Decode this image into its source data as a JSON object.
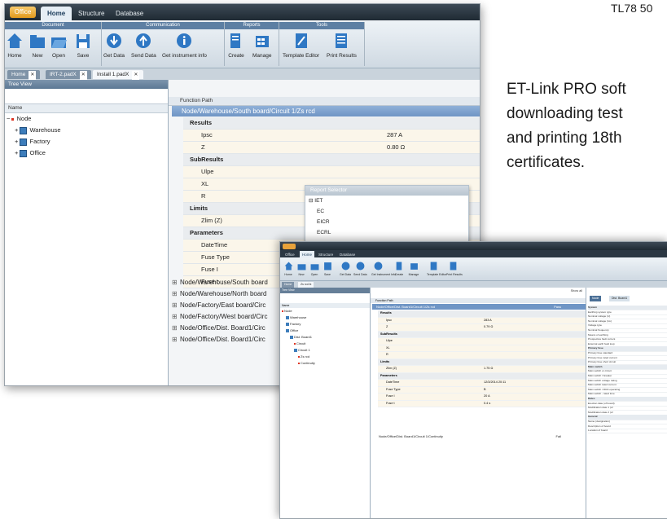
{
  "model_code": "TL78 50",
  "description_lines": [
    "ET-Link PRO soft",
    "downloading test",
    "and printing 18th",
    "certificates."
  ],
  "screenshot_back": {
    "app_button": "Office",
    "menu_tabs": [
      "Home",
      "Structure",
      "Database"
    ],
    "ribbon_groups": [
      "Document",
      "Communication",
      "Reports",
      "Tools"
    ],
    "ribbon_buttons": [
      "Home",
      "New",
      "Open",
      "Save",
      "Get Data",
      "Send Data",
      "Get instrument info",
      "Create",
      "Manage",
      "Template Editor",
      "Print Results"
    ],
    "doc_tabs": [
      "Home",
      "IRT-2.padX",
      "Install 1.padX"
    ],
    "tree_view_title": "Tree View",
    "tree_column": "Name",
    "tree_items": [
      "Node",
      "Warehouse",
      "Factory",
      "Office"
    ],
    "grid_column": "Function Path",
    "selected_path": "Node/Warehouse/South board/Circuit 1/Zs rcd",
    "details": [
      {
        "kind": "hdr",
        "label": "Results",
        "value": ""
      },
      {
        "kind": "fld",
        "label": "Ipsc",
        "value": "287 A"
      },
      {
        "kind": "fld",
        "label": "Z",
        "value": "0.80 Ω"
      },
      {
        "kind": "hdr",
        "label": "SubResults",
        "value": ""
      },
      {
        "kind": "fld",
        "label": "Ulpe",
        "value": ""
      },
      {
        "kind": "fld",
        "label": "XL",
        "value": ""
      },
      {
        "kind": "fld",
        "label": "R",
        "value": ""
      },
      {
        "kind": "hdr",
        "label": "Limits",
        "value": ""
      },
      {
        "kind": "fld",
        "label": "Zlim (Z)",
        "value": ""
      },
      {
        "kind": "hdr",
        "label": "Parameters",
        "value": ""
      },
      {
        "kind": "fld",
        "label": "DateTime",
        "value": ""
      },
      {
        "kind": "fld",
        "label": "Fuse Type",
        "value": ""
      },
      {
        "kind": "fld",
        "label": "Fuse I",
        "value": ""
      },
      {
        "kind": "fld",
        "label": "Fuse t",
        "value": ""
      }
    ],
    "collapsed_rows": [
      "Node/Warehouse/South board",
      "Node/Warehouse/North board",
      "Node/Factory/East board/Circ",
      "Node/Factory/West board/Circ",
      "Node/Office/Dist. Board1/Circ",
      "Node/Office/Dist. Board1/Circ"
    ],
    "report_selector": {
      "title": "Report Selector",
      "items": [
        "IET",
        "EC",
        "EICR",
        "ECRL"
      ]
    }
  },
  "screenshot_front": {
    "menu_tabs": [
      "Office",
      "Home",
      "Structure",
      "Database"
    ],
    "ribbon_buttons": [
      "Home",
      "New",
      "Open",
      "Save",
      "Get Data",
      "Send Data",
      "Get Instrument Info",
      "Create",
      "Manage",
      "Template Editor",
      "Print Results"
    ],
    "doc_tabs": [
      "Home",
      "Zs rcd.fx"
    ],
    "tree_view_title": "Tree View",
    "tree_column": "Name",
    "tree_items": [
      "Node",
      "Warehouse",
      "Factory",
      "Office",
      "Dist. Board1",
      "Circuit",
      "Circuit 1",
      "Zs rcd",
      "Continuity"
    ],
    "show_all": "Show all",
    "grid_column": "Function Path",
    "selected_path": "Node/Office/Dist. Board1/Circuit 1/Zs rcd",
    "selected_status": "Pass",
    "details": [
      {
        "kind": "hdr",
        "label": "Results",
        "value": ""
      },
      {
        "kind": "fld",
        "label": "Ipsc",
        "value": "283 A"
      },
      {
        "kind": "fld",
        "label": "Z",
        "value": "0.79 Ω"
      },
      {
        "kind": "hdr",
        "label": "SubResults",
        "value": ""
      },
      {
        "kind": "fld",
        "label": "Ulpe",
        "value": ""
      },
      {
        "kind": "fld",
        "label": "XL",
        "value": ""
      },
      {
        "kind": "fld",
        "label": "R",
        "value": ""
      },
      {
        "kind": "hdr",
        "label": "Limits",
        "value": ""
      },
      {
        "kind": "fld",
        "label": "Zlim (Z)",
        "value": "1.75 Ω"
      },
      {
        "kind": "hdr",
        "label": "Parameters",
        "value": ""
      },
      {
        "kind": "fld",
        "label": "DateTime",
        "value": "12/3/2014 20:11"
      },
      {
        "kind": "fld",
        "label": "Fuse Type",
        "value": "B"
      },
      {
        "kind": "fld",
        "label": "Fuse I",
        "value": "20 A"
      },
      {
        "kind": "fld",
        "label": "Fuse t",
        "value": "0.4 s"
      }
    ],
    "next_row": "Node/Office/Dist. Board1/Circuit 1/Continuity",
    "next_status": "Fail",
    "right_tabs": [
      "Node",
      "Dist. Board1"
    ],
    "properties": [
      {
        "kind": "cat",
        "label": "System"
      },
      {
        "kind": "fld",
        "label": "Earthing system type"
      },
      {
        "kind": "fld",
        "label": "Nominal voltage (U)"
      },
      {
        "kind": "fld",
        "label": "Nominal voltage (Uo)"
      },
      {
        "kind": "fld",
        "label": "Voltage type"
      },
      {
        "kind": "fld",
        "label": "Nominal frequency"
      },
      {
        "kind": "fld",
        "label": "Means of earthing"
      },
      {
        "kind": "fld",
        "label": "Prospective fault current"
      },
      {
        "kind": "fld",
        "label": "External earth fault loop"
      },
      {
        "kind": "cat",
        "label": "Primary fuse"
      },
      {
        "kind": "fld",
        "label": "Primary fuse standard"
      },
      {
        "kind": "fld",
        "label": "Primary fuse rated current"
      },
      {
        "kind": "fld",
        "label": "Primary fuse short circuit"
      },
      {
        "kind": "cat",
        "label": "Main switch"
      },
      {
        "kind": "fld",
        "label": "Main switch or circuit"
      },
      {
        "kind": "fld",
        "label": "Main switch / breaker"
      },
      {
        "kind": "fld",
        "label": "Main switch voltage rating"
      },
      {
        "kind": "fld",
        "label": "Main switch rated current"
      },
      {
        "kind": "fld",
        "label": "Main switch / RCD operating"
      },
      {
        "kind": "fld",
        "label": "Main switch - rated time"
      },
      {
        "kind": "cat",
        "label": "Dates"
      },
      {
        "kind": "fld",
        "label": "Erection date (of board)"
      },
      {
        "kind": "fld",
        "label": "Modification date 1 (of"
      },
      {
        "kind": "fld",
        "label": "Modification date 2 (of"
      },
      {
        "kind": "cat",
        "label": "General"
      },
      {
        "kind": "fld",
        "label": "Name (designation)"
      },
      {
        "kind": "fld",
        "label": "Description of board"
      },
      {
        "kind": "fld",
        "label": "Location of board"
      }
    ]
  }
}
